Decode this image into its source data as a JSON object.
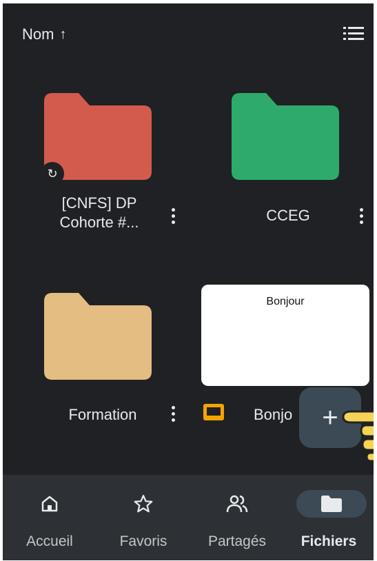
{
  "header": {
    "sort_label": "Nom",
    "sort_direction_icon": "arrow-up-icon",
    "view_toggle_icon": "list-view-icon"
  },
  "items": [
    {
      "name_line1": "[CNFS] DP",
      "name_line2": "Cohorte #...",
      "type": "folder",
      "color": "#d35b4d",
      "shared": true
    },
    {
      "name": "CCEG",
      "type": "folder",
      "color": "#2eab6c"
    },
    {
      "name": "Formation",
      "type": "folder",
      "color": "#e4bd82"
    },
    {
      "name": "Bonjo",
      "type": "slides",
      "preview_text": "Bonjour",
      "icon_color": "#f4a400"
    }
  ],
  "fab": {
    "label": "+",
    "icon": "plus-icon"
  },
  "bottom_nav": {
    "items": [
      {
        "label": "Accueil",
        "icon": "home-icon",
        "active": false
      },
      {
        "label": "Favoris",
        "icon": "star-icon",
        "active": false
      },
      {
        "label": "Partagés",
        "icon": "people-icon",
        "active": false
      },
      {
        "label": "Fichiers",
        "icon": "folder-icon",
        "active": true
      }
    ]
  },
  "colors": {
    "background": "#202124",
    "nav_background": "#2d3136",
    "active_pill": "#3c4a55",
    "text": "#e8eaed"
  }
}
